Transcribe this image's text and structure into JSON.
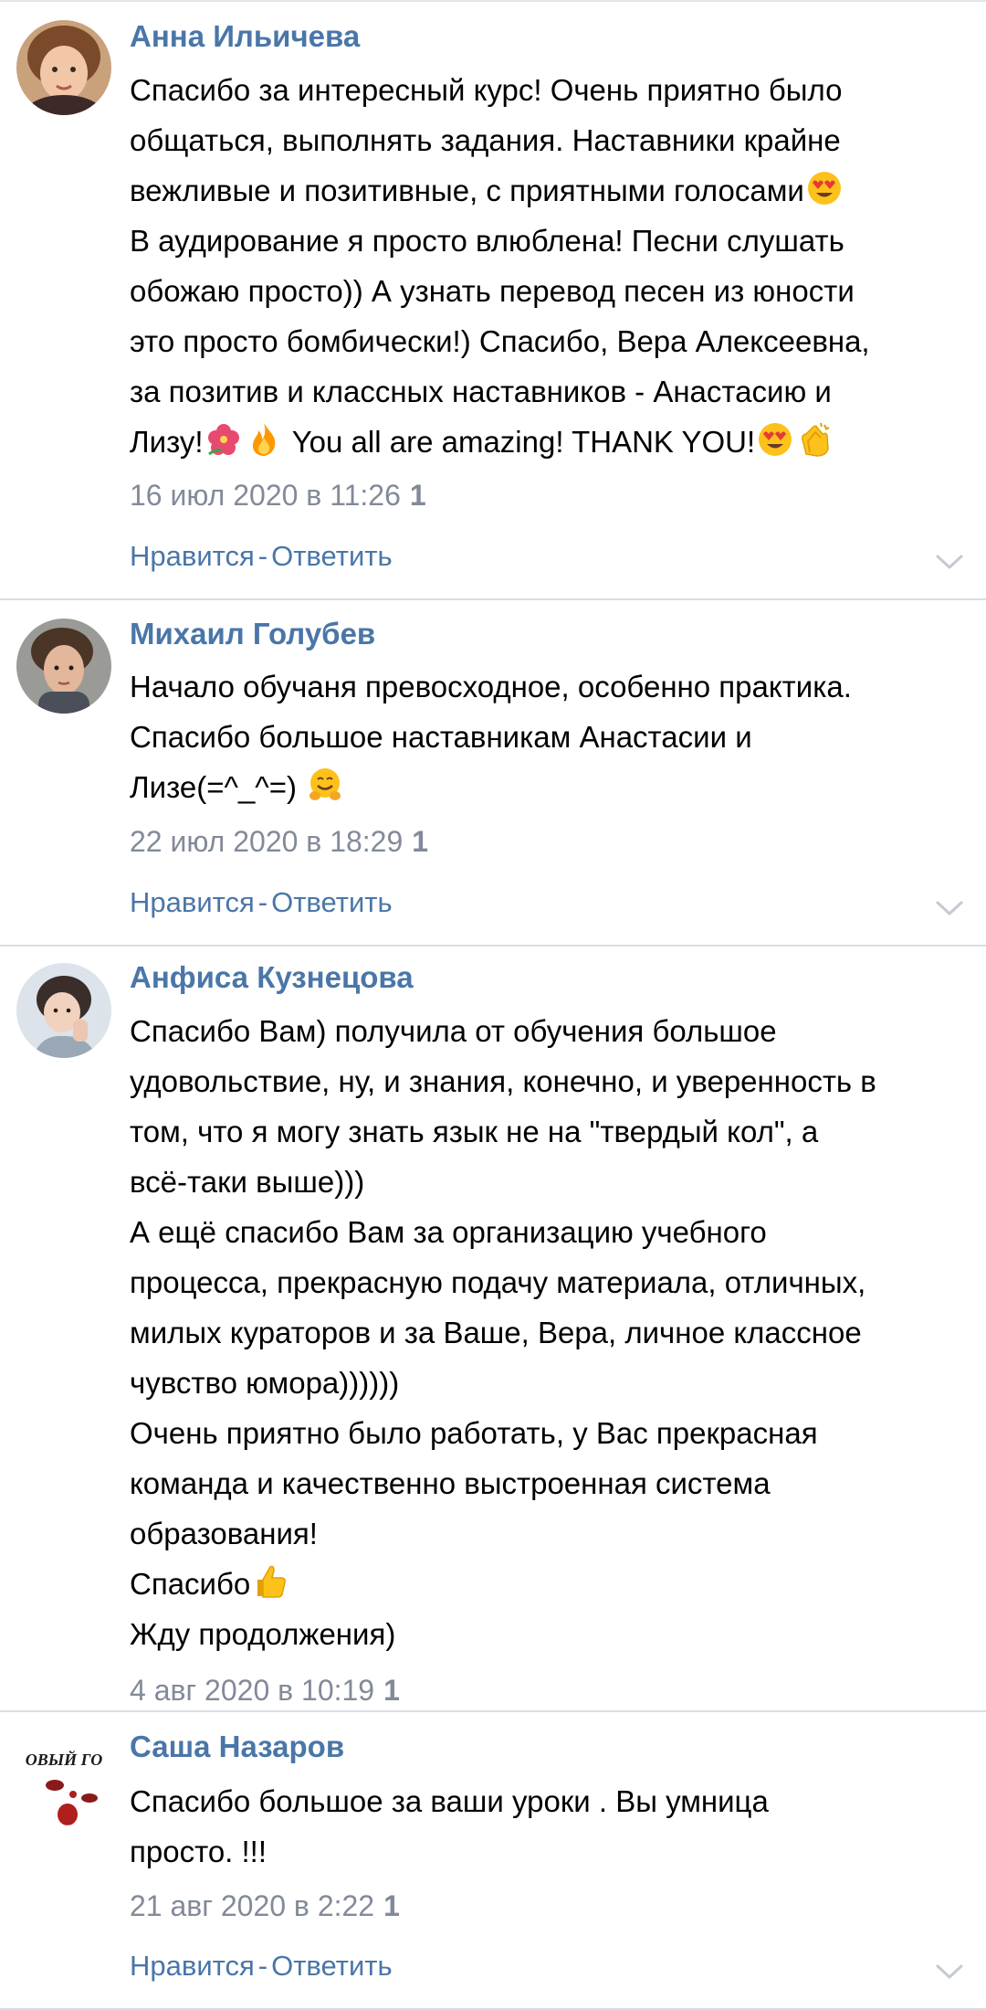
{
  "comments": [
    {
      "author": "Анна Ильичева",
      "lines": [
        "Спасибо за интересный курс! Очень приятно было",
        "общаться, выполнять задания. Наставники крайне",
        "вежливые и позитивные, с приятными голосами",
        "В аудирование я просто влюблена! Песни слушать",
        "обожаю просто)) А узнать перевод песен из юности",
        "это просто бомбически!) Спасибо, Вера Алексеевна,",
        "за позитив и классных наставников - Анастасию и",
        "Лизу!",
        "You all are amazing! THANK YOU!"
      ],
      "date": "16 июл 2020 в 11:26",
      "likes": "1",
      "like_label": "Нравится",
      "reply_label": "Ответить"
    },
    {
      "author": "Михаил Голубев",
      "lines": [
        "Начало обучаня превосходное, особенно практика.",
        "Спасибо большое наставникам Анастасии и",
        "Лизе(=^_^=)"
      ],
      "date": "22 июл 2020 в 18:29",
      "likes": "1",
      "like_label": "Нравится",
      "reply_label": "Ответить"
    },
    {
      "author": "Анфиса Кузнецова",
      "lines": [
        "Спасибо Вам) получила от обучения большое",
        "удовольствие, ну, и знания, конечно, и уверенность в",
        "том, что я могу знать язык не на \"твердый кол\", а",
        "всё-таки выше)))",
        "А ещё спасибо Вам за организацию учебного",
        "процесса, прекрасную подачу материала, отличных,",
        "милых кураторов и за Ваше, Вера, личное классное",
        "чувство юмора))))))",
        "Очень приятно было работать, у Вас прекрасная",
        "команда и качественно выстроенная система",
        "образования!",
        "Спасибо",
        "Жду продолжения)"
      ],
      "date": "4 авг 2020 в 10:19",
      "likes": "1"
    },
    {
      "author": "Саша Назаров",
      "avatar_text": "ОВЫЙ ГО",
      "lines": [
        "Спасибо большое за ваши уроки . Вы умница",
        "просто. !!!"
      ],
      "date": "21 авг 2020 в 2:22",
      "likes": "1",
      "like_label": "Нравится",
      "reply_label": "Ответить"
    }
  ],
  "action_separator": "-",
  "icons": {
    "heart_eyes": "smiling-face-with-heart-eyes-icon",
    "hibiscus": "hibiscus-icon",
    "fire": "fire-icon",
    "clap": "clapping-hands-icon",
    "hug": "hugging-face-icon",
    "thumbs_up": "thumbs-up-icon",
    "chevron": "chevron-down-icon"
  },
  "colors": {
    "link": "#4a76a8",
    "meta": "#828a99",
    "divider": "#d9dde3"
  }
}
